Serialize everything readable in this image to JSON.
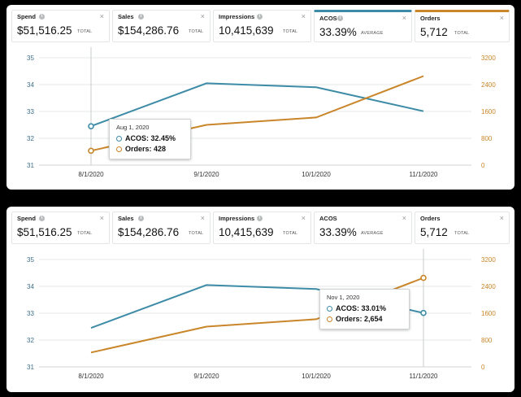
{
  "panels": [
    {
      "metrics": [
        {
          "label": "Spend",
          "value": "$51,516.25",
          "suffix": "TOTAL"
        },
        {
          "label": "Sales",
          "value": "$154,286.76",
          "suffix": "TOTAL"
        },
        {
          "label": "Impressions",
          "value": "10,415,639",
          "suffix": "TOTAL"
        },
        {
          "label": "ACOS",
          "value": "33.39%",
          "suffix": "AVERAGE"
        },
        {
          "label": "Orders",
          "value": "5,712",
          "suffix": "TOTAL"
        }
      ],
      "tooltip": {
        "date": "Aug 1, 2020",
        "acos": "ACOS: 32.45%",
        "orders": "Orders: 428"
      }
    },
    {
      "metrics": [
        {
          "label": "Spend",
          "value": "$51,516.25",
          "suffix": "TOTAL"
        },
        {
          "label": "Sales",
          "value": "$154,286.76",
          "suffix": "TOTAL"
        },
        {
          "label": "Impressions",
          "value": "10,415,639",
          "suffix": "TOTAL"
        },
        {
          "label": "ACOS",
          "value": "33.39%",
          "suffix": "AVERAGE"
        },
        {
          "label": "Orders",
          "value": "5,712",
          "suffix": "TOTAL"
        }
      ],
      "tooltip": {
        "date": "Nov 1, 2020",
        "acos": "ACOS: 33.01%",
        "orders": "Orders: 2,654"
      }
    }
  ],
  "icons": {
    "info": "info-icon",
    "close": "close-icon"
  },
  "colors": {
    "acos": "#3d8ba6",
    "orders": "#c9862a",
    "grid": "#e6e8e8",
    "crosshair": "#c8cccc"
  },
  "chart_data": [
    {
      "type": "line",
      "title": "",
      "x": [
        "8/1/2020",
        "9/1/2020",
        "10/1/2020",
        "11/1/2020"
      ],
      "series": [
        {
          "name": "ACOS",
          "axis": "left",
          "values": [
            32.45,
            34.05,
            33.9,
            33.01
          ]
        },
        {
          "name": "Orders",
          "axis": "right",
          "values": [
            428,
            1200,
            1420,
            2654
          ]
        }
      ],
      "ylim_left": [
        31,
        35
      ],
      "ylim_right": [
        0,
        3200
      ],
      "yticks_left": [
        "35",
        "34",
        "33",
        "32",
        "31"
      ],
      "yticks_right": [
        "3200",
        "2400",
        "1600",
        "800",
        "0"
      ],
      "grid": true,
      "highlight_index": 0
    },
    {
      "type": "line",
      "title": "",
      "x": [
        "8/1/2020",
        "9/1/2020",
        "10/1/2020",
        "11/1/2020"
      ],
      "series": [
        {
          "name": "ACOS",
          "axis": "left",
          "values": [
            32.45,
            34.05,
            33.9,
            33.01
          ]
        },
        {
          "name": "Orders",
          "axis": "right",
          "values": [
            428,
            1200,
            1420,
            2654
          ]
        }
      ],
      "ylim_left": [
        31,
        35
      ],
      "ylim_right": [
        0,
        3200
      ],
      "yticks_left": [
        "35",
        "34",
        "33",
        "32",
        "31"
      ],
      "yticks_right": [
        "3200",
        "2400",
        "1600",
        "800",
        "0"
      ],
      "grid": true,
      "highlight_index": 3
    }
  ]
}
